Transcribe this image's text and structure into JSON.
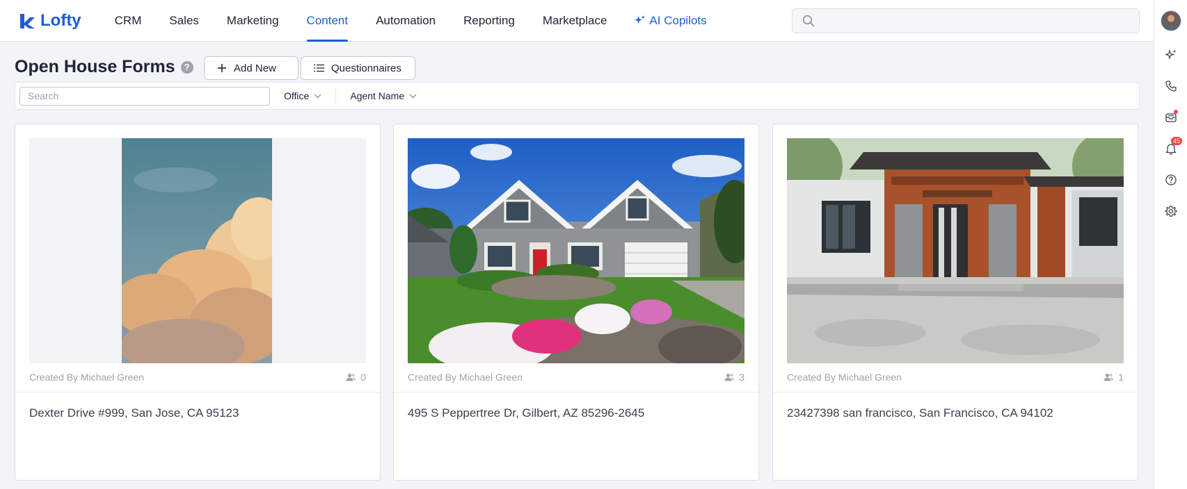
{
  "brand": {
    "name": "Lofty",
    "color": "#1d5cd6"
  },
  "nav": {
    "items": [
      {
        "label": "CRM",
        "active": false
      },
      {
        "label": "Sales",
        "active": false
      },
      {
        "label": "Marketing",
        "active": false
      },
      {
        "label": "Content",
        "active": true
      },
      {
        "label": "Automation",
        "active": false
      },
      {
        "label": "Reporting",
        "active": false
      },
      {
        "label": "Marketplace",
        "active": false
      }
    ],
    "ai_label": "AI Copilots",
    "search_placeholder": ""
  },
  "right_rail": {
    "icons": [
      "sparkle-icon",
      "phone-icon",
      "inbox-icon",
      "bell-icon",
      "help-circle-icon",
      "gear-icon"
    ],
    "notification_count": "45"
  },
  "page": {
    "title": "Open House Forms",
    "add_new_label": "Add New",
    "questionnaires_label": "Questionnaires"
  },
  "filters": {
    "search_placeholder": "Search",
    "office_label": "Office",
    "agent_label": "Agent Name"
  },
  "cards": [
    {
      "created_by": "Created By Michael Green",
      "count": "0",
      "address": "Dexter Drive #999, San Jose, CA 95123"
    },
    {
      "created_by": "Created By Michael Green",
      "count": "3",
      "address": "495 S Peppertree Dr, Gilbert, AZ 85296-2645"
    },
    {
      "created_by": "Created By Michael Green",
      "count": "1",
      "address": "23427398 san francisco, San Francisco, CA 94102"
    }
  ]
}
